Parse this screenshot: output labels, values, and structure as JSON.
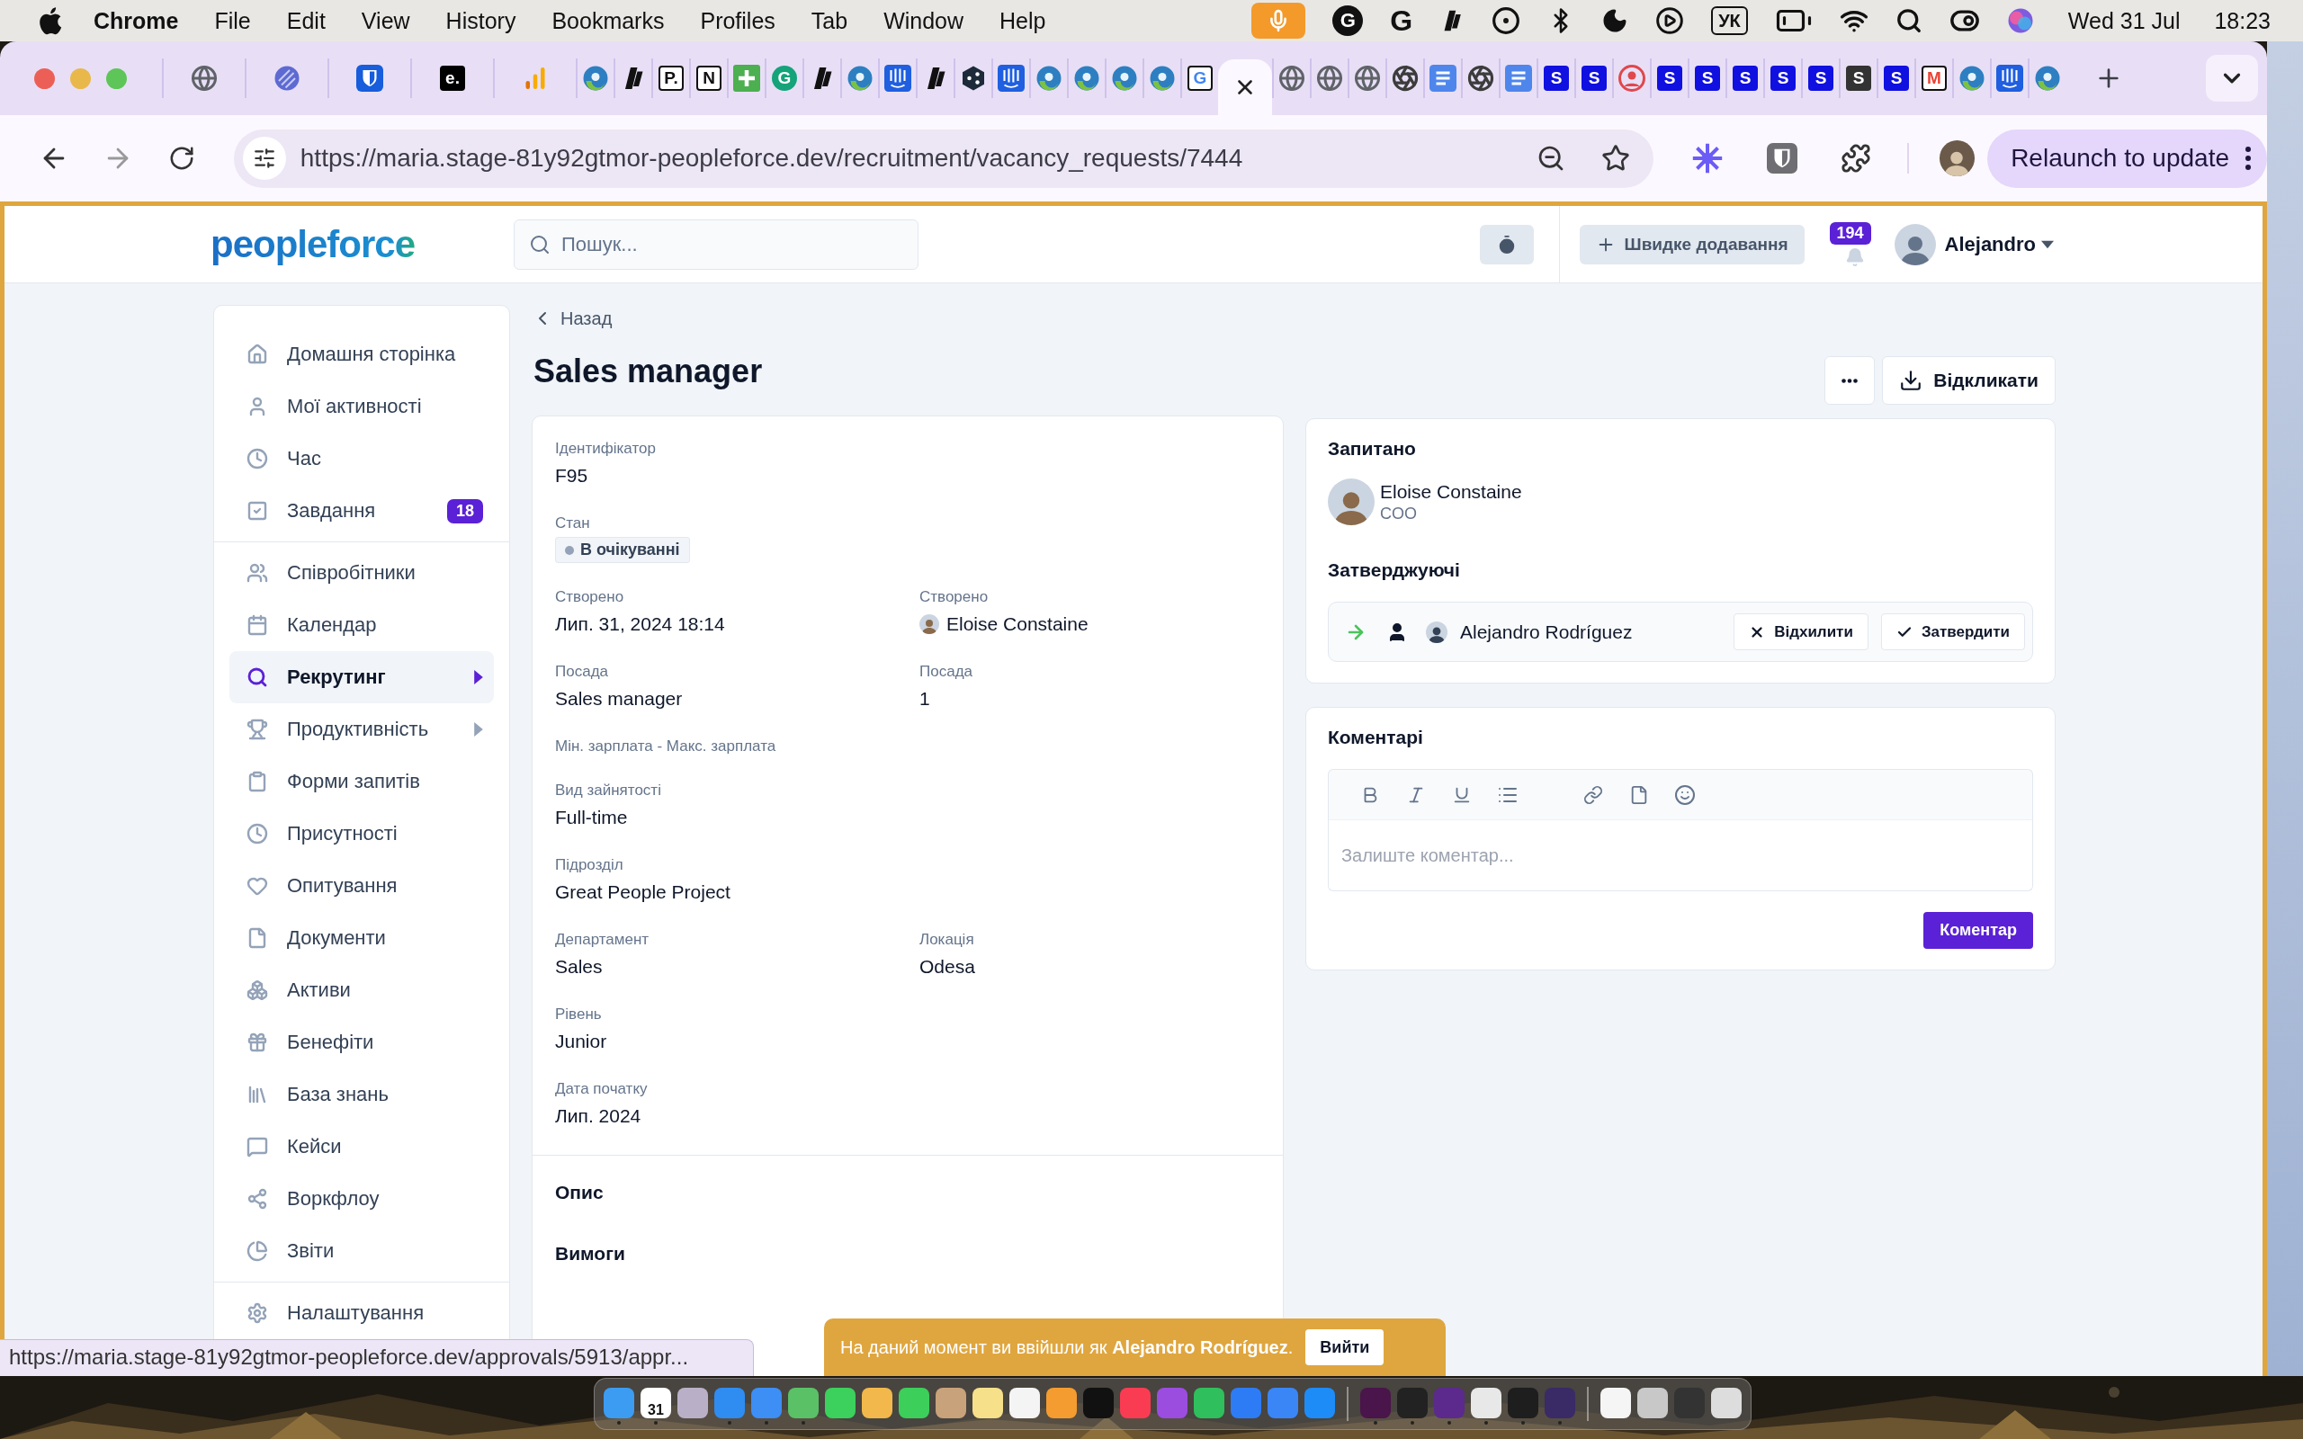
{
  "menu_bar": {
    "app": "Chrome",
    "menus": [
      "File",
      "Edit",
      "View",
      "History",
      "Bookmarks",
      "Profiles",
      "Tab",
      "Window",
      "Help"
    ],
    "status_items": [
      {
        "kind": "mic"
      },
      {
        "kind": "round-letter",
        "glyph": "G"
      },
      {
        "kind": "letter",
        "glyph": "G"
      },
      {
        "kind": "slant"
      },
      {
        "kind": "record"
      },
      {
        "kind": "bluetooth"
      },
      {
        "kind": "moon"
      },
      {
        "kind": "play"
      },
      {
        "kind": "input",
        "glyph": "УК"
      },
      {
        "kind": "battery"
      },
      {
        "kind": "wifi"
      },
      {
        "kind": "search"
      },
      {
        "kind": "control"
      },
      {
        "kind": "siri"
      }
    ],
    "date": "Wed 31 Jul",
    "time": "18:23"
  },
  "browser": {
    "tabs": [
      {
        "kind": "globe",
        "selected": false
      },
      {
        "kind": "orb",
        "selected": false
      },
      {
        "kind": "shield",
        "selected": false
      },
      {
        "kind": "letter",
        "glyph": "e.",
        "color": "#000000",
        "selected": false
      },
      {
        "kind": "bars",
        "selected": false
      },
      {
        "kind": "swirl",
        "selected": false
      },
      {
        "kind": "slant",
        "selected": false
      },
      {
        "kind": "outline-letter",
        "glyph": "P.",
        "color": "#111111",
        "selected": false
      },
      {
        "kind": "outline-letter",
        "glyph": "N",
        "color": "#111111",
        "selected": false
      },
      {
        "kind": "plus",
        "selected": false
      },
      {
        "kind": "round-letter",
        "glyph": "G",
        "color": "#15a37a",
        "selected": false
      },
      {
        "kind": "slant",
        "selected": false
      },
      {
        "kind": "swirl",
        "selected": false
      },
      {
        "kind": "stripes",
        "selected": false
      },
      {
        "kind": "slant",
        "selected": false
      },
      {
        "kind": "hex",
        "selected": false
      },
      {
        "kind": "stripes",
        "selected": false
      },
      {
        "kind": "swirl",
        "selected": false
      },
      {
        "kind": "swirl",
        "selected": false
      },
      {
        "kind": "swirl",
        "selected": false
      },
      {
        "kind": "swirl",
        "selected": false
      },
      {
        "kind": "outline-letter",
        "glyph": "G",
        "color": "#4285f4",
        "selected": false
      },
      {
        "kind": "close",
        "selected": true
      },
      {
        "kind": "globe",
        "selected": false
      },
      {
        "kind": "globe",
        "selected": false
      },
      {
        "kind": "globe",
        "selected": false
      },
      {
        "kind": "chrome",
        "selected": false
      },
      {
        "kind": "doc",
        "selected": false
      },
      {
        "kind": "chrome",
        "selected": false
      },
      {
        "kind": "doc",
        "selected": false
      },
      {
        "kind": "letter",
        "glyph": "S",
        "color": "#1010e0",
        "selected": false
      },
      {
        "kind": "letter",
        "glyph": "S",
        "color": "#1010e0",
        "selected": false
      },
      {
        "kind": "person",
        "selected": false
      },
      {
        "kind": "letter",
        "glyph": "S",
        "color": "#1010e0",
        "selected": false
      },
      {
        "kind": "letter",
        "glyph": "S",
        "color": "#1010e0",
        "selected": false
      },
      {
        "kind": "letter",
        "glyph": "S",
        "color": "#1010e0",
        "selected": false
      },
      {
        "kind": "letter",
        "glyph": "S",
        "color": "#1010e0",
        "selected": false
      },
      {
        "kind": "letter",
        "glyph": "S",
        "color": "#1010e0",
        "selected": false
      },
      {
        "kind": "letter",
        "glyph": "S",
        "color": "#333333",
        "selected": false
      },
      {
        "kind": "letter",
        "glyph": "S",
        "color": "#1010e0",
        "selected": false
      },
      {
        "kind": "outline-letter",
        "glyph": "M",
        "color": "#ea4335",
        "selected": false
      },
      {
        "kind": "swirl",
        "selected": false
      },
      {
        "kind": "stripes",
        "selected": false
      },
      {
        "kind": "swirl",
        "selected": false
      }
    ],
    "url": "https://maria.stage-81y92gtmor-peopleforce.dev/recruitment/vacancy_requests/7444",
    "relaunch": "Relaunch to update",
    "status_url": "https://maria.stage-81y92gtmor-peopleforce.dev/approvals/5913/appr..."
  },
  "app": {
    "logo": "peopleforce",
    "search": {
      "placeholder": "Пошук..."
    },
    "quick_add": "Швидке додавання",
    "notifications": "194",
    "user": "Alejandro"
  },
  "sidebar": {
    "groups": [
      {
        "items": [
          {
            "label": "Домашня сторінка",
            "selected": false,
            "has_submenu": false
          },
          {
            "label": "Мої активності",
            "selected": false,
            "has_submenu": false
          },
          {
            "label": "Час",
            "selected": false,
            "has_submenu": false
          },
          {
            "label": "Завдання",
            "badge": "18",
            "selected": false,
            "has_submenu": false
          }
        ]
      },
      {
        "items": [
          {
            "label": "Співробітники",
            "selected": false,
            "has_submenu": false
          },
          {
            "label": "Календар",
            "selected": false,
            "has_submenu": false
          },
          {
            "label": "Рекрутинг",
            "selected": true,
            "has_submenu": true
          },
          {
            "label": "Продуктивність",
            "selected": false,
            "has_submenu": true
          },
          {
            "label": "Форми запитів",
            "selected": false,
            "has_submenu": false
          },
          {
            "label": "Присутності",
            "selected": false,
            "has_submenu": false
          },
          {
            "label": "Опитування",
            "selected": false,
            "has_submenu": false
          },
          {
            "label": "Документи",
            "selected": false,
            "has_submenu": false
          },
          {
            "label": "Активи",
            "selected": false,
            "has_submenu": false
          },
          {
            "label": "Бенефіти",
            "selected": false,
            "has_submenu": false
          },
          {
            "label": "База знань",
            "selected": false,
            "has_submenu": false
          },
          {
            "label": "Кейси",
            "selected": false,
            "has_submenu": false
          },
          {
            "label": "Воркфлоу",
            "selected": false,
            "has_submenu": false
          },
          {
            "label": "Звіти",
            "selected": false,
            "has_submenu": false
          }
        ]
      },
      {
        "items": [
          {
            "label": "Налаштування",
            "selected": false,
            "has_submenu": false
          }
        ]
      }
    ]
  },
  "back_link": "Назад",
  "title": "Sales manager",
  "withdraw": "Відкликати",
  "details": {
    "rows": [
      {
        "fields": [
          {
            "kind": "text",
            "label": "Ідентифікатор",
            "value": "F95"
          }
        ]
      },
      {
        "fields": [
          {
            "kind": "status",
            "label": "Стан",
            "value": "В очікуванні"
          }
        ]
      },
      {
        "fields": [
          {
            "kind": "text",
            "label": "Створено",
            "value": "Лип. 31, 2024 18:14"
          },
          {
            "kind": "person",
            "label": "Створено",
            "value": "Eloise Constaine"
          }
        ]
      },
      {
        "fields": [
          {
            "kind": "text",
            "label": "Посада",
            "value": "Sales manager"
          },
          {
            "kind": "text",
            "label": "Посада",
            "value": "1"
          }
        ]
      },
      {
        "fields": [
          {
            "kind": "label",
            "label": "Мін. зарплата - Макс. зарплата"
          }
        ]
      },
      {
        "fields": [
          {
            "kind": "text",
            "label": "Вид зайнятості",
            "value": "Full-time"
          }
        ]
      },
      {
        "fields": [
          {
            "kind": "text",
            "label": "Підрозділ",
            "value": "Great People Project"
          }
        ]
      },
      {
        "fields": [
          {
            "kind": "text",
            "label": "Департамент",
            "value": "Sales"
          },
          {
            "kind": "text",
            "label": "Локація",
            "value": "Odesa"
          }
        ]
      },
      {
        "fields": [
          {
            "kind": "text",
            "label": "Рівень",
            "value": "Junior"
          }
        ]
      },
      {
        "fields": [
          {
            "kind": "text",
            "label": "Дата початку",
            "value": "Лип. 2024"
          }
        ]
      }
    ],
    "sections": [
      "Опис",
      "Вимоги"
    ]
  },
  "requested": {
    "title": "Запитано",
    "name": "Eloise Constaine",
    "role": "COO"
  },
  "approvers": {
    "title": "Затверджуючі",
    "items": [
      {
        "name": "Alejandro Rodríguez",
        "reject": "Відхилити",
        "approve": "Затвердити"
      }
    ]
  },
  "comments": {
    "title": "Коментарі",
    "placeholder": "Залиште коментар...",
    "submit": "Коментар"
  },
  "banner": {
    "text": "На даний момент ви ввійшли як **Alejandro Rodríguez**.",
    "button": "Вийти"
  },
  "dock": [
    {
      "kind": "app",
      "running": true
    },
    {
      "kind": "calendar",
      "glyph": "31",
      "running": true
    },
    {
      "kind": "app",
      "running": false
    },
    {
      "kind": "app",
      "running": true
    },
    {
      "kind": "app",
      "running": true
    },
    {
      "kind": "app",
      "running": true
    },
    {
      "kind": "app",
      "running": false
    },
    {
      "kind": "app",
      "running": false
    },
    {
      "kind": "app",
      "running": false
    },
    {
      "kind": "app",
      "running": false
    },
    {
      "kind": "app",
      "running": false
    },
    {
      "kind": "app",
      "running": false
    },
    {
      "kind": "app",
      "running": false
    },
    {
      "kind": "app",
      "running": false
    },
    {
      "kind": "app",
      "running": false
    },
    {
      "kind": "app",
      "running": false
    },
    {
      "kind": "app",
      "running": false
    },
    {
      "kind": "app",
      "running": false
    },
    {
      "kind": "app",
      "running": false
    },
    {
      "kind": "app",
      "running": false
    },
    {
      "kind": "divider"
    },
    {
      "kind": "app",
      "running": true
    },
    {
      "kind": "app",
      "running": true
    },
    {
      "kind": "app",
      "running": true
    },
    {
      "kind": "app",
      "running": true
    },
    {
      "kind": "app",
      "running": true
    },
    {
      "kind": "app",
      "running": true
    },
    {
      "kind": "divider"
    },
    {
      "kind": "app",
      "running": false
    },
    {
      "kind": "app",
      "running": false
    },
    {
      "kind": "app",
      "running": false
    },
    {
      "kind": "app",
      "running": false
    }
  ]
}
